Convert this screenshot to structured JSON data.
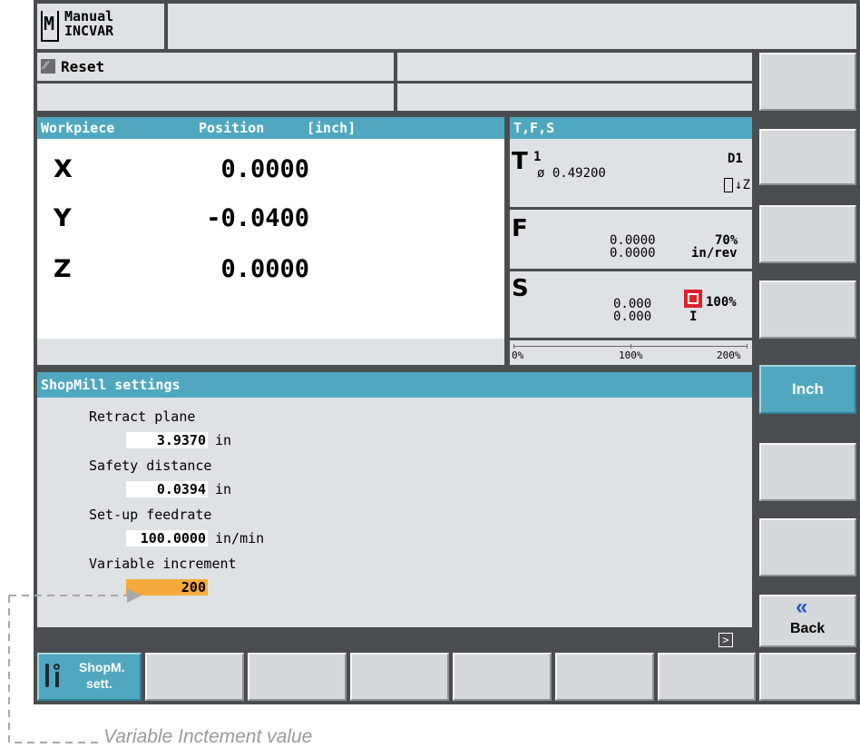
{
  "header": {
    "mode_line1": "Manual",
    "mode_line2": "INCVAR",
    "mode_icon": "M"
  },
  "status": {
    "channel_text": "Reset"
  },
  "workpiece": {
    "title": "Workpiece",
    "position_label": "Position",
    "unit_label": "[inch]",
    "axes": [
      {
        "name": "X",
        "value": "0.0000"
      },
      {
        "name": "Y",
        "value": "-0.0400"
      },
      {
        "name": "Z",
        "value": "0.0000"
      }
    ]
  },
  "tfs": {
    "title": "T,F,S",
    "tool": {
      "letter": "T",
      "number": "1",
      "diameter": "ø 0.49200",
      "d": "D1",
      "tool_icon": "drill-z-icon",
      "axis": "Z"
    },
    "feed": {
      "letter": "F",
      "value1": "0.0000",
      "value2": "0.0000",
      "override": "70%",
      "unit": "in/rev"
    },
    "spindle": {
      "letter": "S",
      "value1": "0.000",
      "value2": "0.000",
      "override": "100%",
      "dir": "I",
      "stop_icon_color": "#e0202a"
    },
    "scale": [
      "0%",
      "100%",
      "200%"
    ]
  },
  "settings": {
    "title": "ShopMill settings",
    "fields": [
      {
        "label": "Retract plane",
        "value": "3.9370",
        "unit": "in"
      },
      {
        "label": "Safety distance",
        "value": "0.0394",
        "unit": "in"
      },
      {
        "label": "Set-up feedrate",
        "value": "100.0000",
        "unit": "in/min"
      },
      {
        "label": "Variable increment",
        "value": "200",
        "unit": ""
      }
    ]
  },
  "vertical_softkeys": {
    "inch": "Inch",
    "back": "Back",
    "back_icon": "«"
  },
  "horizontal_softkeys": {
    "shopm_line1": "ShopM.",
    "shopm_line2": "sett."
  },
  "annotation": {
    "text": "Variable Inctement value"
  },
  "colors": {
    "teal": "#4fa8bf",
    "highlight": "#f6aa3c",
    "panel": "#dfe2e5",
    "frame": "#4a4d50"
  }
}
